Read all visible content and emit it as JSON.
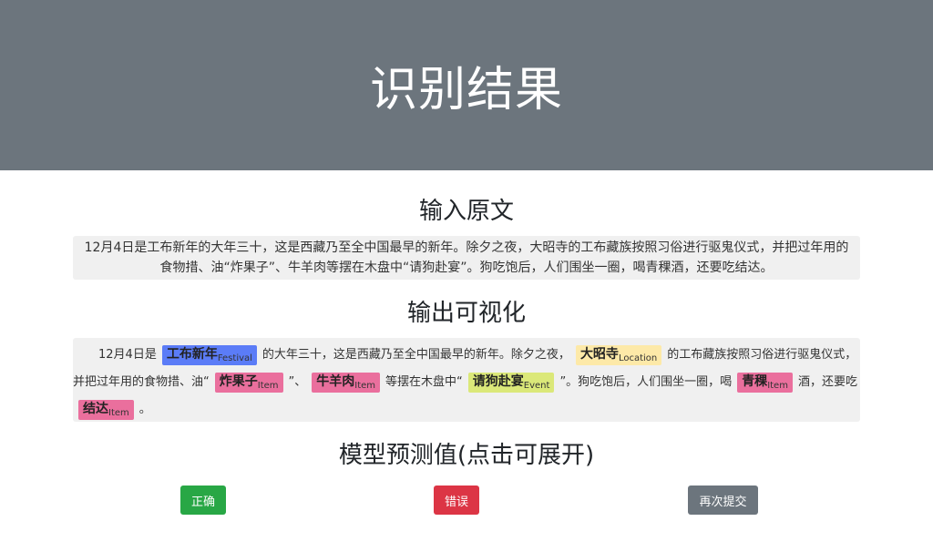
{
  "header": {
    "title": "识别结果"
  },
  "input_section": {
    "title": "输入原文",
    "text": "12月4日是工布新年的大年三十，这是西藏乃至全中国最早的新年。除夕之夜，大昭寺的工布藏族按照习俗进行驱鬼仪式，并把过年用的食物措、油“炸果子”、牛羊肉等摆在木盘中“请狗赴宴”。狗吃饱后，人们围坐一圈，喝青稞酒，还要吃结达。"
  },
  "output_section": {
    "title": "输出可视化",
    "segments": {
      "s0": "12月4日是",
      "s1": "的大年三十，这是西藏乃至全中国最早的新年。除夕之夜，",
      "s2": "的工布藏族按照习俗进行驱鬼仪式，并把过年用的食物措、油“",
      "s3": "”、",
      "s4": "等摆在木盘中“",
      "s5": "”。狗吃饱后，人们围坐一圈，喝",
      "s6": "酒，还要吃",
      "s7": "。"
    },
    "entities": {
      "e0": {
        "text": "工布新年",
        "label": "Festival",
        "color": "#5b7cf7"
      },
      "e1": {
        "text": "大昭寺",
        "label": "Location",
        "color": "#fde9a8"
      },
      "e2": {
        "text": "炸果子",
        "label": "Item",
        "color": "#ea6f9d"
      },
      "e3": {
        "text": "牛羊肉",
        "label": "Item",
        "color": "#ea6f9d"
      },
      "e4": {
        "text": "请狗赴宴",
        "label": "Event",
        "color": "#dbe879"
      },
      "e5": {
        "text": "青稞",
        "label": "Item",
        "color": "#ea6f9d"
      },
      "e6": {
        "text": "结达",
        "label": "Item",
        "color": "#ea6f9d"
      }
    }
  },
  "prediction_section": {
    "title": "模型预测值(点击可展开)",
    "buttons": {
      "correct": {
        "label": "正确",
        "color": "#28a745"
      },
      "wrong": {
        "label": "错误",
        "color": "#dc3545"
      },
      "resubmit": {
        "label": "再次提交",
        "color": "#6c757d"
      }
    }
  }
}
